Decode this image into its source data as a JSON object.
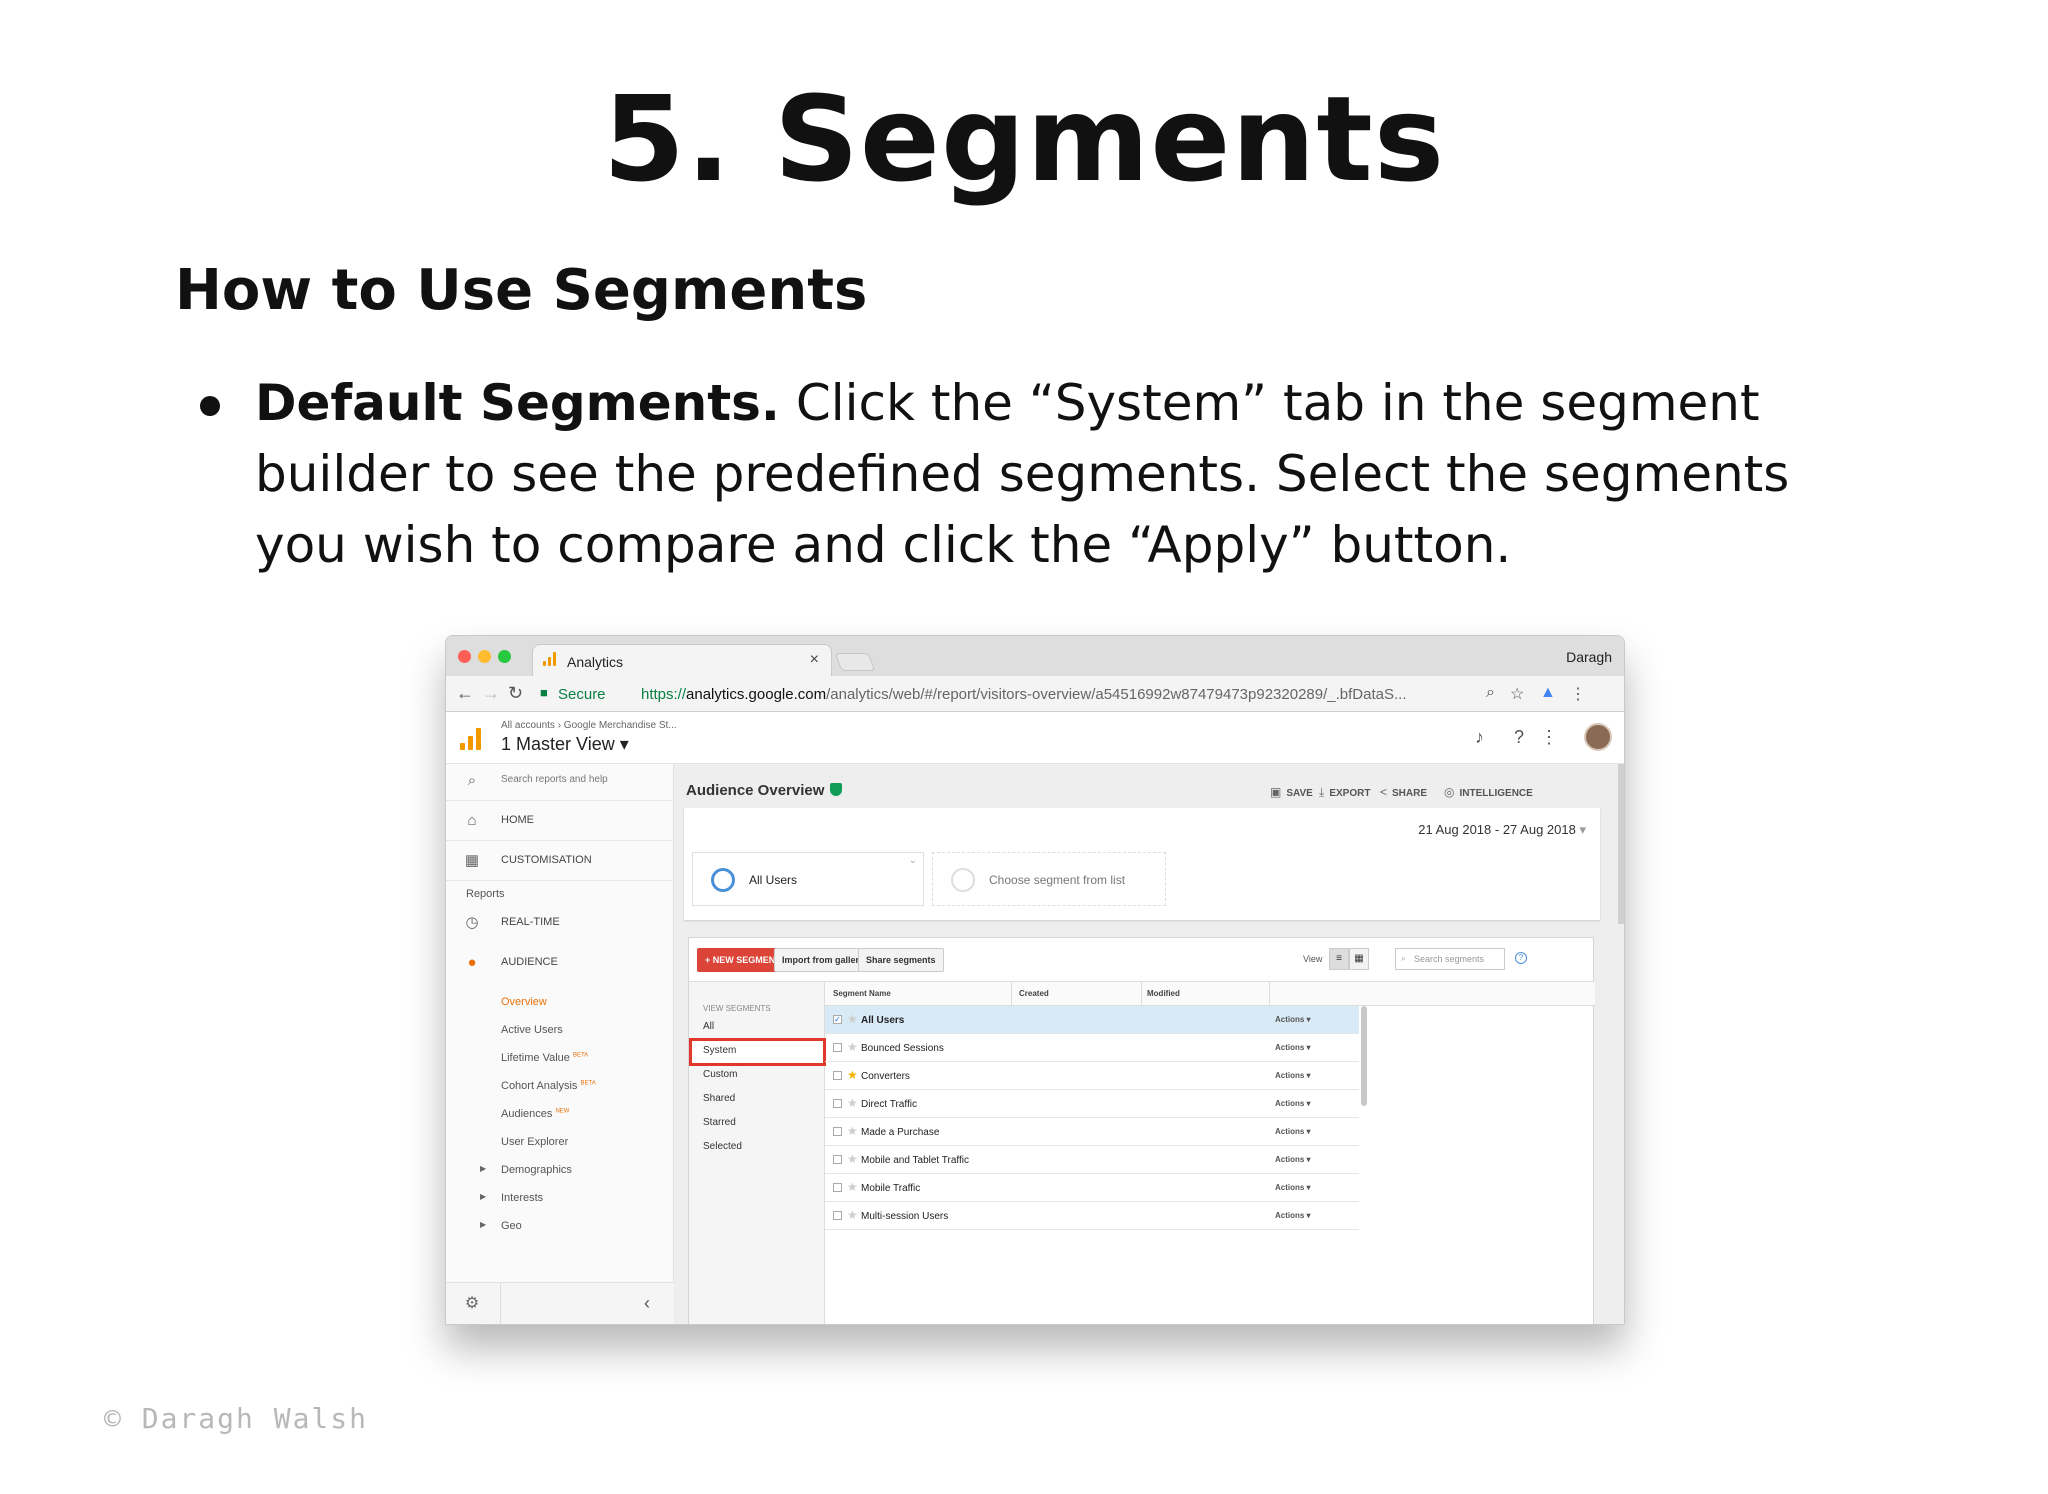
{
  "slide": {
    "title": "5. Segments",
    "subtitle": "How to Use Segments",
    "bullet_bold": "Default Segments.",
    "bullet_text": " Click the “System” tab in the segment builder to see the predefined segments. Select the segments you wish to compare and click the “Apply” button.",
    "copyright": "© Daragh Walsh"
  },
  "browser": {
    "tab_title": "Analytics",
    "tab_close": "×",
    "profile_name": "Daragh",
    "secure_label": "Secure",
    "url_scheme": "https://",
    "url_host": "analytics.google.com",
    "url_path": "/analytics/web/#/report/visitors-overview/a54516992w87479473p92320289/_.bfDataS..."
  },
  "ga_header": {
    "breadcrumb": "All accounts › Google Merchandise St...",
    "view_name": "1 Master View ▾"
  },
  "sidenav": {
    "search_placeholder": "Search reports and help",
    "home": "HOME",
    "customisation": "CUSTOMISATION",
    "reports_section": "Reports",
    "realtime": "REAL-TIME",
    "audience": "AUDIENCE",
    "sub_items": [
      {
        "label": "Overview",
        "badge": ""
      },
      {
        "label": "Active Users",
        "badge": ""
      },
      {
        "label": "Lifetime Value",
        "badge": "BETA"
      },
      {
        "label": "Cohort Analysis",
        "badge": "BETA"
      },
      {
        "label": "Audiences",
        "badge": "NEW"
      },
      {
        "label": "User Explorer",
        "badge": ""
      }
    ],
    "expandable": [
      "Demographics",
      "Interests",
      "Geo"
    ],
    "collapse_glyph": "‹"
  },
  "report": {
    "title": "Audience Overview",
    "actions": {
      "save": "SAVE",
      "export": "EXPORT",
      "share": "SHARE",
      "intelligence": "INTELLIGENCE"
    },
    "date_range": "21 Aug 2018 - 27 Aug 2018",
    "segment_1": "All Users",
    "segment_2": "Choose segment from list"
  },
  "builder": {
    "new_segment": "+ NEW SEGMENT",
    "import_gallery": "Import from gallery",
    "share_segments": "Share segments",
    "view_label": "View",
    "search_placeholder": "Search segments",
    "help": "?",
    "menu_header": "VIEW SEGMENTS",
    "menu_items": [
      "All",
      "System",
      "Custom",
      "Shared",
      "Starred",
      "Selected"
    ],
    "columns": [
      "Segment Name",
      "Created",
      "Modified"
    ],
    "rows": [
      {
        "name": "All Users",
        "checked": true,
        "starred": false,
        "actions": "Actions ▾"
      },
      {
        "name": "Bounced Sessions",
        "checked": false,
        "starred": false,
        "actions": "Actions ▾"
      },
      {
        "name": "Converters",
        "checked": false,
        "starred": true,
        "actions": "Actions ▾"
      },
      {
        "name": "Direct Traffic",
        "checked": false,
        "starred": false,
        "actions": "Actions ▾"
      },
      {
        "name": "Made a Purchase",
        "checked": false,
        "starred": false,
        "actions": "Actions ▾"
      },
      {
        "name": "Mobile and Tablet Traffic",
        "checked": false,
        "starred": false,
        "actions": "Actions ▾"
      },
      {
        "name": "Mobile Traffic",
        "checked": false,
        "starred": false,
        "actions": "Actions ▾"
      },
      {
        "name": "Multi-session Users",
        "checked": false,
        "starred": false,
        "actions": "Actions ▾"
      }
    ]
  },
  "colors": {
    "highlight_border": "#e0392b",
    "new_segment_bg": "#db4437",
    "secure_green": "#0b8043",
    "ga_orange": "#f29900",
    "selected_row": "#d8eaf6"
  }
}
